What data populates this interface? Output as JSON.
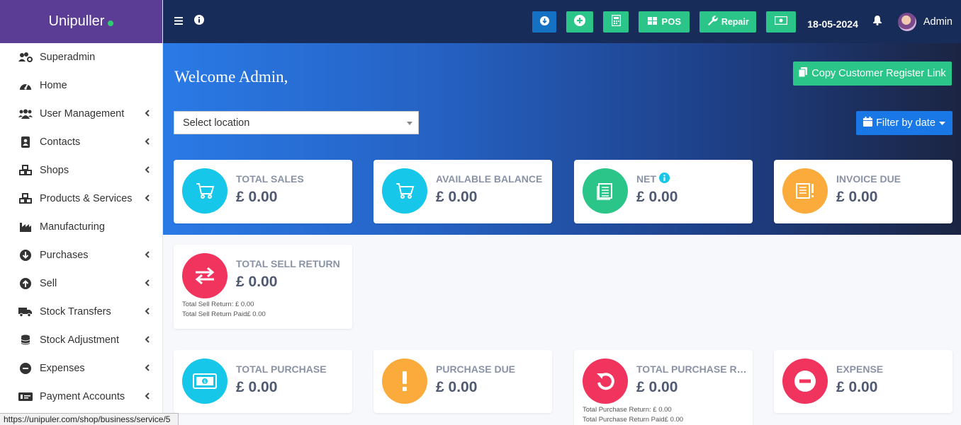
{
  "brand": {
    "name": "Unipuller"
  },
  "sidebar": {
    "items": [
      {
        "label": "Superadmin",
        "icon": "users-cog-icon",
        "has_submenu": false
      },
      {
        "label": "Home",
        "icon": "dashboard-icon",
        "has_submenu": false
      },
      {
        "label": "User Management",
        "icon": "users-icon",
        "has_submenu": true
      },
      {
        "label": "Contacts",
        "icon": "address-book-icon",
        "has_submenu": true
      },
      {
        "label": "Shops",
        "icon": "cubes-icon",
        "has_submenu": true
      },
      {
        "label": "Products & Services",
        "icon": "cubes-icon",
        "has_submenu": true
      },
      {
        "label": "Manufacturing",
        "icon": "industry-icon",
        "has_submenu": false
      },
      {
        "label": "Purchases",
        "icon": "arrow-circle-down-icon",
        "has_submenu": true
      },
      {
        "label": "Sell",
        "icon": "arrow-circle-up-icon",
        "has_submenu": true
      },
      {
        "label": "Stock Transfers",
        "icon": "truck-icon",
        "has_submenu": true
      },
      {
        "label": "Stock Adjustment",
        "icon": "database-icon",
        "has_submenu": true
      },
      {
        "label": "Expenses",
        "icon": "minus-circle-icon",
        "has_submenu": true
      },
      {
        "label": "Payment Accounts",
        "icon": "money-check-icon",
        "has_submenu": true
      }
    ]
  },
  "topbar": {
    "pos_label": "POS",
    "repair_label": "Repair",
    "date": "18-05-2024",
    "user": "Admin"
  },
  "main": {
    "welcome": "Welcome Admin,",
    "copy_button": "Copy Customer Register Link",
    "location_select": "Select location",
    "filter_button": "Filter by date",
    "cards": [
      {
        "title": "TOTAL SALES",
        "value": "£ 0.00"
      },
      {
        "title": "AVAILABLE BALANCE",
        "value": "£ 0.00"
      },
      {
        "title": "NET",
        "value": "£ 0.00"
      },
      {
        "title": "INVOICE DUE",
        "value": "£ 0.00"
      },
      {
        "title": "TOTAL SELL RETURN",
        "value": "£ 0.00",
        "notes": [
          "Total Sell Return: £ 0.00",
          "Total Sell Return Paid£ 0.00"
        ]
      },
      {
        "title": "TOTAL PURCHASE",
        "value": "£ 0.00"
      },
      {
        "title": "PURCHASE DUE",
        "value": "£ 0.00"
      },
      {
        "title": "TOTAL PURCHASE RETURN",
        "value": "£ 0.00",
        "notes": [
          "Total Purchase Return: £ 0.00",
          "Total Purchase Return Paid£ 0.00"
        ]
      },
      {
        "title": "EXPENSE",
        "value": "£ 0.00"
      }
    ]
  },
  "status_url": "https://unipuler.com/shop/business/service/5",
  "colors": {
    "sidebar_brand": "#5b3d96",
    "topbar": "#182c5a",
    "accent_green": "#2bc58a",
    "accent_blue": "#1978e6",
    "cyan": "#16c7e9",
    "orange": "#fbab3b",
    "red": "#f1345e"
  }
}
